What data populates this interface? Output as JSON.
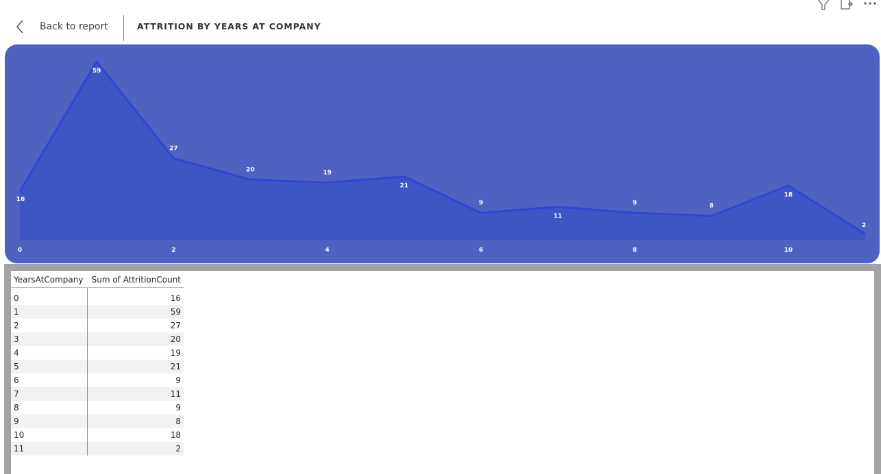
{
  "header": {
    "back_label": "Back to report",
    "title": "ATTRITION BY YEARS AT COMPANY",
    "icons": [
      "filter-icon",
      "focus-mode-icon",
      "more-options-icon"
    ]
  },
  "colors": {
    "card_background": "#4f62bf",
    "area_fill": "#3a55c4",
    "line": "#2e46d6",
    "label": "#ffffff"
  },
  "chart_data": {
    "type": "area",
    "title": "ATTRITION BY YEARS AT COMPANY",
    "xlabel": "",
    "ylabel": "",
    "x": [
      0,
      1,
      2,
      3,
      4,
      5,
      6,
      7,
      8,
      9,
      10,
      11
    ],
    "x_ticks": [
      "0",
      "2",
      "4",
      "6",
      "8",
      "10"
    ],
    "series": [
      {
        "values": [
          16,
          59,
          27,
          20,
          19,
          21,
          9,
          11,
          9,
          8,
          18,
          2
        ]
      }
    ],
    "data_labels": [
      "16",
      "59",
      "27",
      "20",
      "19",
      "21",
      "9",
      "11",
      "9",
      "8",
      "18",
      "2"
    ],
    "xlim": [
      0,
      11
    ],
    "ylim": [
      0,
      59
    ],
    "grid": false,
    "legend": "none"
  },
  "table": {
    "columns": [
      "YearsAtCompany",
      "Sum of AttritionCount"
    ],
    "rows": [
      [
        "0",
        "16"
      ],
      [
        "1",
        "59"
      ],
      [
        "2",
        "27"
      ],
      [
        "3",
        "20"
      ],
      [
        "4",
        "19"
      ],
      [
        "5",
        "21"
      ],
      [
        "6",
        "9"
      ],
      [
        "7",
        "11"
      ],
      [
        "8",
        "9"
      ],
      [
        "9",
        "8"
      ],
      [
        "10",
        "18"
      ],
      [
        "11",
        "2"
      ]
    ]
  }
}
